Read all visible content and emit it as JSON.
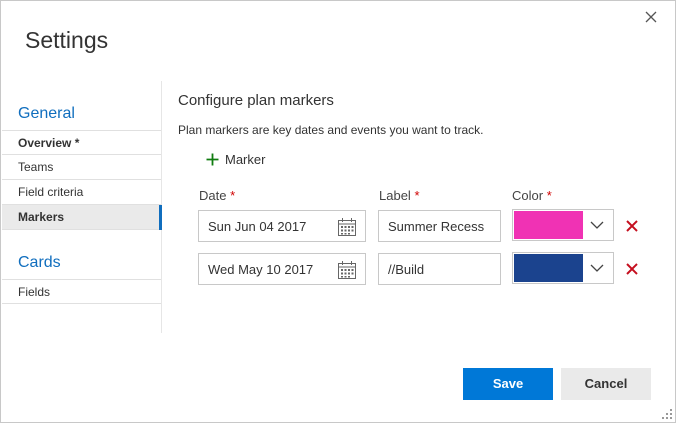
{
  "dialog": {
    "title": "Settings",
    "close_icon": "close-icon"
  },
  "sidebar": {
    "groups": [
      {
        "header": "General",
        "items": [
          {
            "label": "Overview *",
            "state": "bold"
          },
          {
            "label": "Teams",
            "state": "normal"
          },
          {
            "label": "Field criteria",
            "state": "normal"
          },
          {
            "label": "Markers",
            "state": "selected"
          }
        ]
      },
      {
        "header": "Cards",
        "items": [
          {
            "label": "Fields",
            "state": "normal"
          }
        ]
      }
    ]
  },
  "main": {
    "section_title": "Configure plan markers",
    "description": "Plan markers are key dates and events you want to track.",
    "add_marker_label": "Marker",
    "columns": {
      "date": "Date",
      "label": "Label",
      "color": "Color",
      "required_mark": "*"
    },
    "markers": [
      {
        "date": "Sun Jun 04 2017",
        "label": "Summer Recess",
        "color": "#f032b4"
      },
      {
        "date": "Wed May 10 2017",
        "label": "//Build",
        "color": "#1b438e"
      }
    ]
  },
  "footer": {
    "save_label": "Save",
    "cancel_label": "Cancel"
  },
  "colors": {
    "accent": "#0078d7",
    "nav_accent": "#106ebe",
    "delete": "#c50f1f",
    "add": "#107c10"
  }
}
